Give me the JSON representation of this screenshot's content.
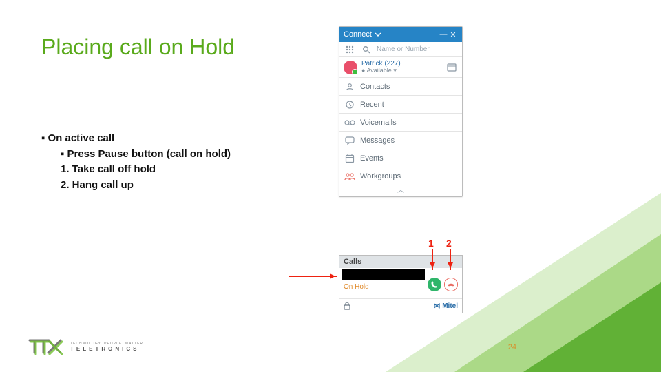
{
  "title": "Placing call on Hold",
  "bullets": {
    "top": "On active call",
    "sub1": "Press Pause button (call on hold)",
    "num1": "1. Take call off hold",
    "num2": "2. Hang call up"
  },
  "app": {
    "title": "Connect",
    "search_placeholder": "Name or Number",
    "user_name": "Patrick (227)",
    "user_status": "Available",
    "nav": {
      "contacts": "Contacts",
      "recent": "Recent",
      "voicemails": "Voicemails",
      "messages": "Messages",
      "events": "Events",
      "workgroups": "Workgroups"
    }
  },
  "calls": {
    "header": "Calls",
    "status": "On Hold",
    "footer_brand": "Mitel"
  },
  "annotations": {
    "one": "1",
    "two": "2"
  },
  "footer": {
    "brand": "TELETRONICS",
    "tagline": "TECHNOLOGY. PEOPLE. MATTER."
  },
  "page_number": "24"
}
